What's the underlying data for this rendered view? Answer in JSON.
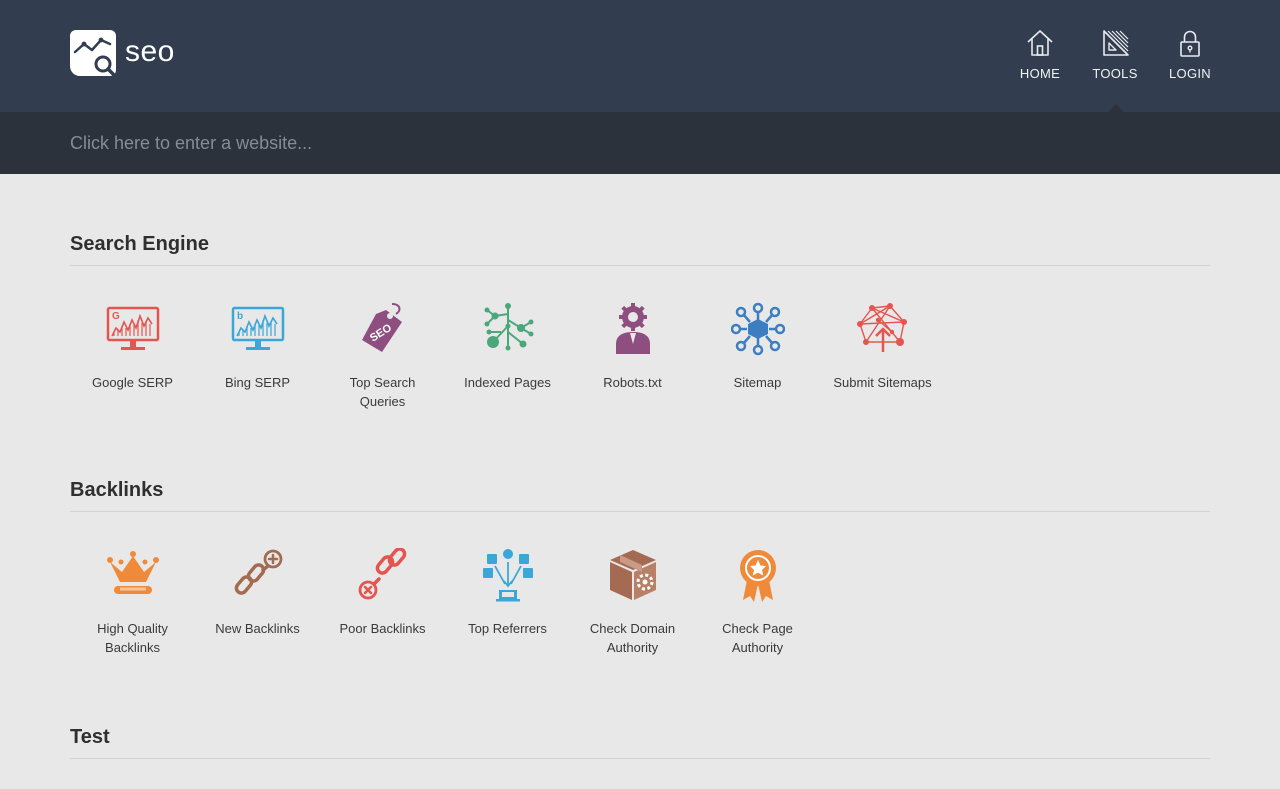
{
  "brand": {
    "name": "seo"
  },
  "nav": {
    "home": {
      "label": "HOME",
      "icon": "home-icon"
    },
    "tools": {
      "label": "TOOLS",
      "icon": "ruler-triangle-icon"
    },
    "login": {
      "label": "LOGIN",
      "icon": "lock-icon"
    }
  },
  "search": {
    "placeholder": "Click here to enter a website...",
    "value": ""
  },
  "sections": [
    {
      "title": "Search Engine",
      "tools": [
        {
          "label": "Google SERP",
          "icon": "google-chart-monitor-icon",
          "color": "#e5554f"
        },
        {
          "label": "Bing SERP",
          "icon": "bing-chart-monitor-icon",
          "color": "#3aa7d8"
        },
        {
          "label": "Top Search Queries",
          "icon": "seo-tag-icon",
          "color": "#8e4e80"
        },
        {
          "label": "Indexed Pages",
          "icon": "network-tree-icon",
          "color": "#4aa77a"
        },
        {
          "label": "Robots.txt",
          "icon": "robot-gear-person-icon",
          "color": "#8e4e80"
        },
        {
          "label": "Sitemap",
          "icon": "sitemap-hub-icon",
          "color": "#3c7ec0"
        },
        {
          "label": "Submit Sitemaps",
          "icon": "submit-network-icon",
          "color": "#e5554f"
        }
      ]
    },
    {
      "title": "Backlinks",
      "tools": [
        {
          "label": "High Quality Backlinks",
          "icon": "crown-icon",
          "color": "#f08a3b"
        },
        {
          "label": "New Backlinks",
          "icon": "chain-plus-icon",
          "color": "#a56b52"
        },
        {
          "label": "Poor Backlinks",
          "icon": "chain-minus-icon",
          "color": "#e5554f"
        },
        {
          "label": "Top Referrers",
          "icon": "social-referrers-icon",
          "color": "#3aa7d8"
        },
        {
          "label": "Check Domain Authority",
          "icon": "box-gear-icon",
          "color": "#a56b52"
        },
        {
          "label": "Check Page Authority",
          "icon": "award-ribbon-icon",
          "color": "#f08a3b"
        }
      ]
    },
    {
      "title": "Test",
      "tools": []
    }
  ]
}
